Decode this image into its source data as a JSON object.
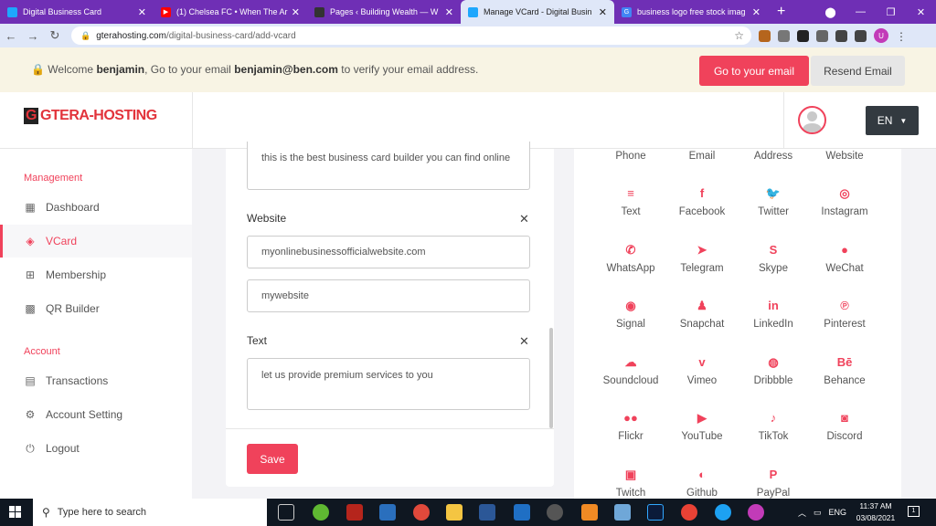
{
  "browser": {
    "tabs": [
      {
        "title": "Digital Business Card",
        "fav_color": "#1ea7fd",
        "active": false
      },
      {
        "title": "(1) Chelsea FC • When The Ar",
        "fav_color": "#ff0000",
        "active": false
      },
      {
        "title": "Pages ‹ Building Wealth — W",
        "fav_color": "#333333",
        "active": false
      },
      {
        "title": "Manage VCard - Digital Busin",
        "fav_color": "#1ea7fd",
        "active": true
      },
      {
        "title": "business logo free stock imag",
        "fav_color": "#4285f4",
        "active": false
      }
    ],
    "url_domain": "gterahosting.com",
    "url_path": "/digital-business-card/add-vcard",
    "profile_initial": "U"
  },
  "banner": {
    "welcome": "Welcome",
    "username": "benjamin",
    "mid": ", Go to your email",
    "email": "benjamin@ben.com",
    "tail": "to verify your email address.",
    "goto_label": "Go to your email",
    "resend_label": "Resend Email"
  },
  "header": {
    "logo_text": "GTERA-HOSTING",
    "lang": "EN"
  },
  "sidebar": {
    "management_label": "Management",
    "account_label": "Account",
    "items": [
      {
        "label": "Dashboard",
        "icon": "▦"
      },
      {
        "label": "VCard",
        "icon": "◈"
      },
      {
        "label": "Membership",
        "icon": "⊞"
      },
      {
        "label": "QR Builder",
        "icon": "▩"
      },
      {
        "label": "Transactions",
        "icon": "▤"
      },
      {
        "label": "Account Setting",
        "icon": "⚙"
      },
      {
        "label": "Logout",
        "icon": "⏻"
      }
    ]
  },
  "form": {
    "about_text": "this is the best business card builder you can find online",
    "website_label": "Website",
    "website_url": "myonlinebusinessofficialwebsite.com",
    "website_name": "mywebsite",
    "text_label": "Text",
    "text_value": "let us provide premium services to you",
    "save_label": "Save"
  },
  "icons": {
    "row0": [
      "Phone",
      "Email",
      "Address",
      "Website"
    ],
    "items": [
      {
        "label": "Text",
        "glyph": "≡"
      },
      {
        "label": "Facebook",
        "glyph": "f"
      },
      {
        "label": "Twitter",
        "glyph": "🐦"
      },
      {
        "label": "Instagram",
        "glyph": "◎"
      },
      {
        "label": "WhatsApp",
        "glyph": "✆"
      },
      {
        "label": "Telegram",
        "glyph": "➤"
      },
      {
        "label": "Skype",
        "glyph": "S"
      },
      {
        "label": "WeChat",
        "glyph": "●"
      },
      {
        "label": "Signal",
        "glyph": "◉"
      },
      {
        "label": "Snapchat",
        "glyph": "♟"
      },
      {
        "label": "LinkedIn",
        "glyph": "in"
      },
      {
        "label": "Pinterest",
        "glyph": "℗"
      },
      {
        "label": "Soundcloud",
        "glyph": "☁"
      },
      {
        "label": "Vimeo",
        "glyph": "v"
      },
      {
        "label": "Dribbble",
        "glyph": "◍"
      },
      {
        "label": "Behance",
        "glyph": "Bē"
      },
      {
        "label": "Flickr",
        "glyph": "●●"
      },
      {
        "label": "YouTube",
        "glyph": "▶"
      },
      {
        "label": "TikTok",
        "glyph": "♪"
      },
      {
        "label": "Discord",
        "glyph": "◙"
      },
      {
        "label": "Twitch",
        "glyph": "▣"
      },
      {
        "label": "Github",
        "glyph": "◐"
      },
      {
        "label": "PayPal",
        "glyph": "P"
      }
    ]
  },
  "taskbar": {
    "search_placeholder": "Type here to search",
    "lang": "ENG",
    "time": "11:37 AM",
    "date": "03/08/2021"
  }
}
